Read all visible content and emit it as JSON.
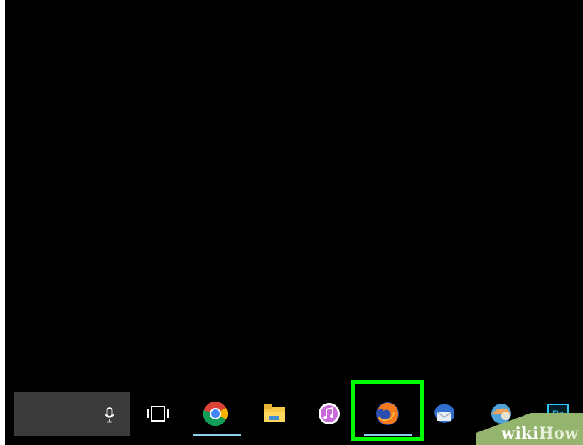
{
  "desktop": {
    "background": "#000000"
  },
  "taskbar": {
    "search": {
      "label": "",
      "icon": "microphone-icon"
    },
    "buttons": [
      {
        "name": "task-view-button",
        "icon": "task-view-icon",
        "running": false
      },
      {
        "name": "chrome-button",
        "icon": "chrome-icon",
        "running": true
      },
      {
        "name": "file-explorer-button",
        "icon": "folder-icon",
        "running": false
      },
      {
        "name": "itunes-button",
        "icon": "itunes-icon",
        "running": false
      },
      {
        "name": "firefox-button",
        "icon": "firefox-icon",
        "running": true,
        "highlighted": true
      },
      {
        "name": "thunderbird-button",
        "icon": "thunderbird-icon",
        "running": false
      },
      {
        "name": "app-button",
        "icon": "app-icon",
        "running": false
      },
      {
        "name": "photoshop-button",
        "icon": "photoshop-icon",
        "label": "Ps",
        "running": false
      }
    ],
    "highlight_color": "#00ff00",
    "running_indicator_color": "#8fd0ee"
  },
  "watermark": {
    "wiki": "wiki",
    "how": "How"
  }
}
